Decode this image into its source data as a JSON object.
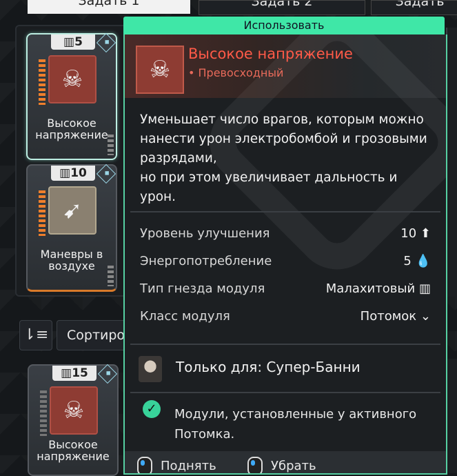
{
  "tabs": [
    {
      "label": "Задать 1"
    },
    {
      "label": "Задать 2"
    },
    {
      "label": "Задать"
    }
  ],
  "left_cards": [
    {
      "cost": "5",
      "name": "Высокое напряжение",
      "selected": true,
      "icon": "skull-icon"
    },
    {
      "cost": "10",
      "name": "Маневры в воздухе",
      "selected": false,
      "icon": "dash-icon"
    },
    {
      "cost": "15",
      "name": "Высокое напряжение",
      "selected": false,
      "icon": "skull-icon"
    }
  ],
  "sort": {
    "label": "Сортиро"
  },
  "popup": {
    "use_label": "Использовать",
    "title": "Высокое напряжение",
    "rank": "• Превосходный",
    "description": "Уменьшает число врагов, которым можно нанести урон электробомбой и грозовыми разрядами,\nно при этом увеличивает дальность и урон.",
    "stats": [
      {
        "label": "Уровень улучшения",
        "value": "10",
        "icon": "upgrade-arrow-icon"
      },
      {
        "label": "Энергопотребление",
        "value": "5",
        "icon": "drop-icon"
      },
      {
        "label": "Тип гнезда модуля",
        "value": "Малахитовый",
        "icon": "malachite-icon"
      },
      {
        "label": "Класс модуля",
        "value": "Потомок",
        "icon": "descendant-icon"
      }
    ],
    "only_for": "Только для: Супер-Банни",
    "note": "Модули, установленные у активного Потомка.",
    "footer": [
      {
        "label": "Поднять",
        "icon": "mouse-icon"
      },
      {
        "label": "Убрать",
        "icon": "mouse-icon"
      }
    ]
  },
  "colors": {
    "accent": "#3fe7a7",
    "title": "#ff5a48",
    "rank": "#e86a5a"
  }
}
